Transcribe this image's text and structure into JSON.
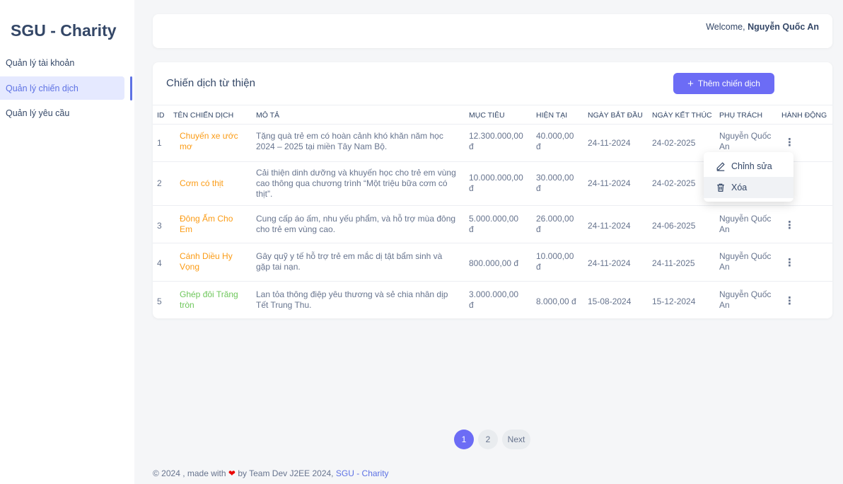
{
  "sidebar": {
    "brand": "SGU - Charity",
    "items": [
      {
        "label": "Quản lý tài khoản"
      },
      {
        "label": "Quản lý chiến dịch"
      },
      {
        "label": "Quản lý yêu cầu"
      }
    ]
  },
  "header": {
    "welcome_prefix": "Welcome,",
    "user_name": "Nguyễn Quốc An"
  },
  "main": {
    "title": "Chiến dịch từ thiện",
    "add_button": "Thêm chiến dịch",
    "columns": [
      "ID",
      "TÊN CHIẾN DỊCH",
      "MÔ TẢ",
      "MỤC TIÊU",
      "HIỆN TẠI",
      "NGÀY BẮT ĐẦU",
      "NGÀY KẾT THÚC",
      "PHỤ TRÁCH",
      "HÀNH ĐỘNG"
    ],
    "rows": [
      {
        "id": "1",
        "name_l1": "Chuyến xe ước",
        "name_l2": "mơ",
        "desc_l1": "Tặng quà trẻ em có hoàn cảnh khó khăn năm học",
        "desc_l2": "2024 – 2025 tại miền Tây Nam Bộ.",
        "desc_l3": "",
        "goal_l1": "12.300.000,00",
        "goal_l2": "đ",
        "current_l1": "40.000,00",
        "current_l2": "đ",
        "start": "24-11-2024",
        "end": "24-02-2025",
        "owner_l1": "Nguyễn Quốc",
        "owner_l2": "An"
      },
      {
        "id": "2",
        "name_l1": "Cơm có thịt",
        "name_l2": "",
        "desc_l1": "Cải thiện dinh dưỡng và khuyến học cho trẻ em vùng",
        "desc_l2": "cao thông qua chương trình “Một triệu bữa cơm có",
        "desc_l3": "thịt”.",
        "goal_l1": "10.000.000,00",
        "goal_l2": "đ",
        "current_l1": "30.000,00",
        "current_l2": "đ",
        "start": "24-11-2024",
        "end": "24-02-2025",
        "owner_l1": "",
        "owner_l2": ""
      },
      {
        "id": "3",
        "name_l1": "Đông Ấm Cho",
        "name_l2": "Em",
        "desc_l1": "Cung cấp áo ấm, nhu yếu phẩm, và hỗ trợ mùa đông",
        "desc_l2": "cho trẻ em vùng cao.",
        "desc_l3": "",
        "goal_l1": "5.000.000,00",
        "goal_l2": "đ",
        "current_l1": "26.000,00",
        "current_l2": "đ",
        "start": "24-11-2024",
        "end": "24-06-2025",
        "owner_l1": "Nguyễn Quốc",
        "owner_l2": "An"
      },
      {
        "id": "4",
        "name_l1": "Cánh Diều Hy",
        "name_l2": "Vọng",
        "desc_l1": "Gây quỹ y tế hỗ trợ trẻ em mắc dị tật bẩm sinh và",
        "desc_l2": "gặp tai nạn.",
        "desc_l3": "",
        "goal_l1": "800.000,00 đ",
        "goal_l2": "",
        "current_l1": "10.000,00",
        "current_l2": "đ",
        "start": "24-11-2024",
        "end": "24-11-2025",
        "owner_l1": "Nguyễn Quốc",
        "owner_l2": "An"
      },
      {
        "id": "5",
        "name_l1": "Ghép đôi Trăng",
        "name_l2": "tròn",
        "desc_l1": "Lan tỏa thông điệp yêu thương và sẻ chia nhân dịp",
        "desc_l2": "Tết Trung Thu.",
        "desc_l3": "",
        "goal_l1": "3.000.000,00",
        "goal_l2": "đ",
        "current_l1": "8.000,00 đ",
        "current_l2": "",
        "start": "15-08-2024",
        "end": "15-12-2024",
        "owner_l1": "Nguyễn Quốc",
        "owner_l2": "An"
      }
    ]
  },
  "dropdown": {
    "edit": "Chỉnh sửa",
    "delete": "Xóa"
  },
  "pagination": {
    "pages": [
      "1",
      "2"
    ],
    "next": "Next",
    "active": "1"
  },
  "footer": {
    "prefix": "© 2024 , made with",
    "middle": "by Team Dev J2EE 2024,",
    "link": "SGU - Charity"
  },
  "colors": {
    "accent": "#6c6cf5",
    "orange_name": "#fb9b14",
    "green_name": "#6ec75b",
    "heart": "#ea0606"
  }
}
